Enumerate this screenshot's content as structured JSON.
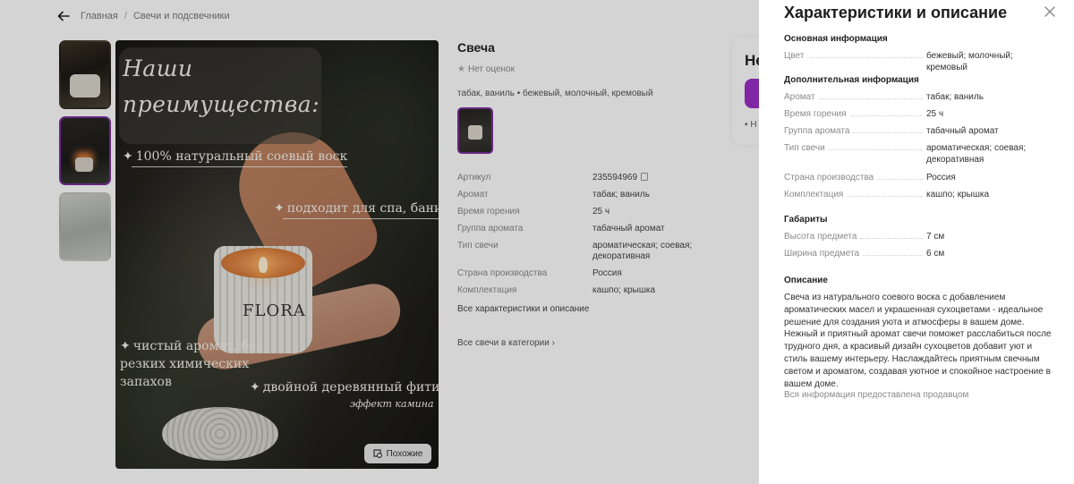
{
  "breadcrumbs": [
    "Главная",
    "Свечи и подсвечники"
  ],
  "gallery": {
    "hero": {
      "title": "Наши преимущества:",
      "features": [
        "100% натуральный соевый воск",
        "подходит для спа, бани",
        "чистый аромат, без резких химических запахов",
        "двойной деревянный фитиль",
        "эффект камина"
      ],
      "logo_text": "FLORA",
      "similar_label": "Похожие"
    }
  },
  "product": {
    "name": "Свеча",
    "rating": "Нет оценок",
    "variant": "табак, ваниль • бежевый, молочный, кремовый",
    "specs": [
      {
        "key": "Артикул",
        "value": "235594969"
      },
      {
        "key": "Аромат",
        "value": "табак; ваниль"
      },
      {
        "key": "Время горения",
        "value": "25 ч"
      },
      {
        "key": "Группа аромата",
        "value": "табачный аромат"
      },
      {
        "key": "Тип свечи",
        "value": "ароматическая; соевая; декоративная"
      },
      {
        "key": "Страна производства",
        "value": "Россия"
      },
      {
        "key": "Комплектация",
        "value": "кашпо; крышка"
      }
    ],
    "all_specs_link": "Все характеристики и описание",
    "category_link": "Все свечи в категории"
  },
  "buy_box": {
    "price_fragment": "Не",
    "icon_fragment": "Н"
  },
  "panel": {
    "title": "Характеристики и описание",
    "sections": [
      {
        "title": "Основная информация",
        "rows": [
          {
            "key": "Цвет",
            "value": "бежевый; молочный; кремовый"
          }
        ]
      },
      {
        "title": "Дополнительная информация",
        "rows": [
          {
            "key": "Аромат",
            "value": "табак; ваниль"
          },
          {
            "key": "Время горения",
            "value": "25 ч"
          },
          {
            "key": "Группа аромата",
            "value": "табачный аромат"
          },
          {
            "key": "Тип свечи",
            "value": "ароматическая; соевая; декоративная"
          },
          {
            "key": "Страна производства",
            "value": "Россия"
          },
          {
            "key": "Комплектация",
            "value": "кашпо; крышка"
          }
        ]
      },
      {
        "title": "Габариты",
        "rows": [
          {
            "key": "Высота предмета",
            "value": "7 см"
          },
          {
            "key": "Ширина предмета",
            "value": "6 см"
          }
        ]
      }
    ],
    "description_title": "Описание",
    "description": "Свеча из натурального соевого воска с добавлением ароматических масел и украшенная сухоцветами - идеальное решение для создания уюта и атмосферы в вашем доме. Нежный и приятный аромат свечи поможет расслабиться после трудного дня, а красивый дизайн сухоцветов добавит уют и стиль вашему интерьеру. Наслаждайтесь приятным свечным светом и ароматом, создавая уютное и спокойное настроение в вашем доме.",
    "note": "Вся информация предоставлена продавцом"
  },
  "colors": {
    "accent": "#9b2fc7",
    "selection_border": "#7c2f9c",
    "overlay": "rgba(0,0,0,0.17)"
  }
}
